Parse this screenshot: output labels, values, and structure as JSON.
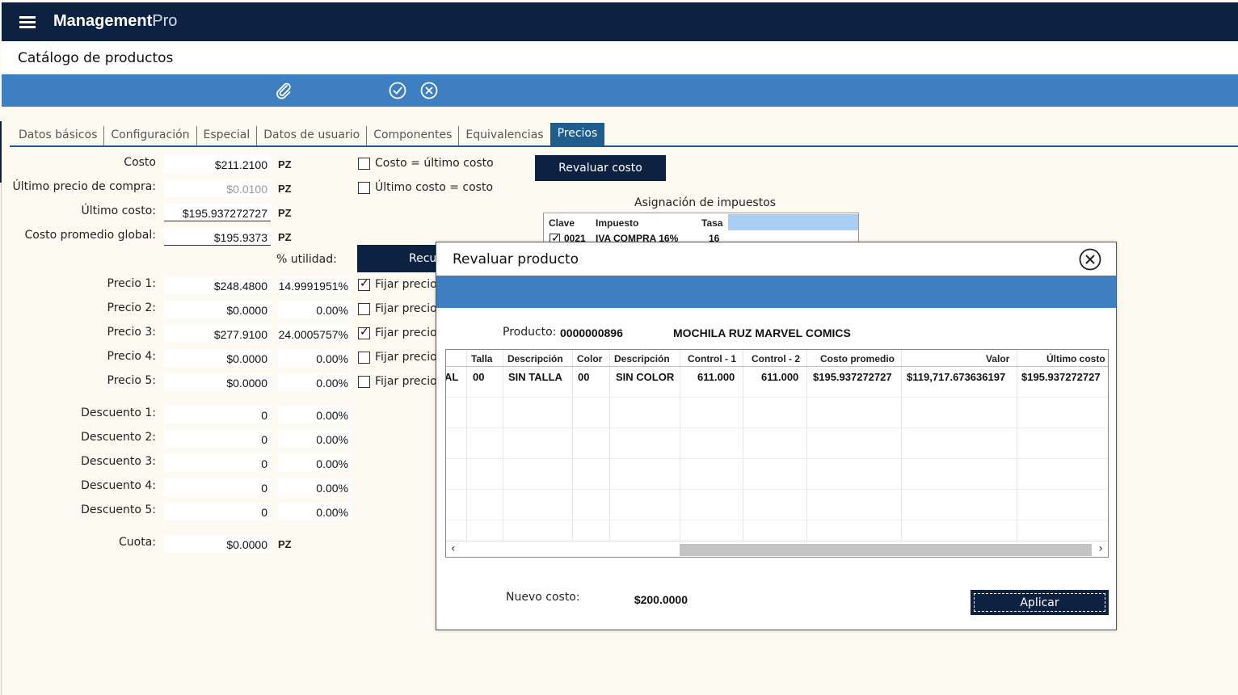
{
  "app": {
    "name_bold": "Management",
    "name_light": "Pro"
  },
  "page": {
    "title": "Catálogo de productos"
  },
  "toolbar": {
    "icons": [
      "paperclip-icon",
      "check-circle-icon",
      "close-circle-icon"
    ]
  },
  "tabs": [
    "Datos básicos",
    "Configuración",
    "Especial",
    "Datos de usuario",
    "Componentes",
    "Equivalencias",
    "Precios"
  ],
  "cost": {
    "costo_label": "Costo",
    "costo": "$211.2100",
    "ultimo_precio_label": "Último precio de compra:",
    "ultimo_precio": "$0.0100",
    "ultimo_costo_label": "Último costo:",
    "ultimo_costo": "$195.937272727",
    "costo_promedio_label": "Costo promedio global:",
    "costo_promedio": "$195.9373",
    "unit": "PZ",
    "utilidad_label": "% utilidad:"
  },
  "checks": {
    "costo_ultimo": "Costo = último costo",
    "ultimo_costo": "Último costo = costo"
  },
  "buttons": {
    "revaluar": "Revaluar costo",
    "recu": "Recu"
  },
  "prices": [
    {
      "label": "Precio 1:",
      "value": "$248.4800",
      "pct": "14.9991951%",
      "fix": "Fijar precio",
      "checked": true
    },
    {
      "label": "Precio 2:",
      "value": "$0.0000",
      "pct": "0.00%",
      "fix": "Fijar precio",
      "checked": false
    },
    {
      "label": "Precio 3:",
      "value": "$277.9100",
      "pct": "24.0005757%",
      "fix": "Fijar precio",
      "checked": true
    },
    {
      "label": "Precio 4:",
      "value": "$0.0000",
      "pct": "0.00%",
      "fix": "Fijar precio",
      "checked": false
    },
    {
      "label": "Precio 5:",
      "value": "$0.0000",
      "pct": "0.00%",
      "fix": "Fijar precio",
      "checked": false
    }
  ],
  "discounts": [
    {
      "label": "Descuento 1:",
      "value": "0",
      "pct": "0.00%"
    },
    {
      "label": "Descuento 2:",
      "value": "0",
      "pct": "0.00%"
    },
    {
      "label": "Descuento 3:",
      "value": "0",
      "pct": "0.00%"
    },
    {
      "label": "Descuento 4:",
      "value": "0",
      "pct": "0.00%"
    },
    {
      "label": "Descuento 5:",
      "value": "0",
      "pct": "0.00%"
    }
  ],
  "cuota": {
    "label": "Cuota:",
    "value": "$0.0000",
    "unit": "PZ"
  },
  "taxes": {
    "title": "Asignación de impuestos",
    "headers": [
      "Clave",
      "Impuesto",
      "Tasa"
    ],
    "row": {
      "checked": true,
      "clave": "0021",
      "impuesto": "IVA COMPRA 16%",
      "tasa": "16"
    }
  },
  "modal": {
    "title": "Revaluar producto",
    "producto_label": "Producto:",
    "producto_code": "0000000896",
    "producto_name": "MOCHILA RUZ MARVEL COMICS",
    "grid_headers": [
      "Talla",
      "Descripción",
      "Color",
      "Descripción",
      "Control - 1",
      "Control - 2",
      "Costo promedio",
      "Valor",
      "Último costo"
    ],
    "grid_row": [
      "\tAL",
      "00",
      "SIN TALLA",
      "00",
      "SIN COLOR",
      "611.000",
      "611.000",
      "$195.937272727",
      "$119,717.673636197",
      "$195.937272727"
    ],
    "nuevo_costo_label": "Nuevo costo:",
    "nuevo_costo": "$200.0000",
    "apply": "Aplicar"
  }
}
